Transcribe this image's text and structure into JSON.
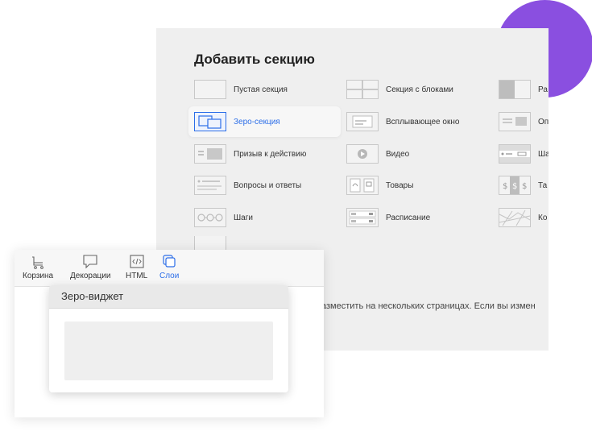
{
  "panel": {
    "title": "Добавить секцию",
    "description": "азместить на нескольких страницах. Если вы измен"
  },
  "sections": {
    "col1": [
      {
        "label": "Пустая секция",
        "icon": "empty-section-icon"
      },
      {
        "label": "Зеро-секция",
        "icon": "zero-section-icon",
        "active": true
      },
      {
        "label": "Призыв к действию",
        "icon": "call-to-action-icon"
      },
      {
        "label": "Вопросы и ответы",
        "icon": "faq-icon"
      },
      {
        "label": "Шаги",
        "icon": "steps-icon"
      }
    ],
    "col2": [
      {
        "label": "Секция с блоками",
        "icon": "blocks-section-icon"
      },
      {
        "label": "Всплывающее окно",
        "icon": "popup-icon"
      },
      {
        "label": "Видео",
        "icon": "video-icon"
      },
      {
        "label": "Товары",
        "icon": "products-icon"
      },
      {
        "label": "Расписание",
        "icon": "schedule-icon"
      }
    ],
    "col3": [
      {
        "label": "Ра",
        "icon": "split-section-icon"
      },
      {
        "label": "Оп",
        "icon": "description-icon"
      },
      {
        "label": "Ша",
        "icon": "template-icon"
      },
      {
        "label": "Та",
        "icon": "pricing-table-icon"
      },
      {
        "label": "Ко",
        "icon": "map-icon"
      }
    ]
  },
  "toolbar": {
    "items": [
      {
        "label": "Корзина",
        "icon": "cart-icon"
      },
      {
        "label": "Декорации",
        "icon": "speech-bubble-icon"
      },
      {
        "label": "HTML",
        "icon": "code-icon"
      },
      {
        "label": "Слои",
        "icon": "layers-icon",
        "active": true
      }
    ]
  },
  "widget": {
    "title": "Зеро-виджет"
  },
  "colors": {
    "accent": "#2c6ee8",
    "purple": "#8a4fe0",
    "panel_bg": "#efefef"
  }
}
